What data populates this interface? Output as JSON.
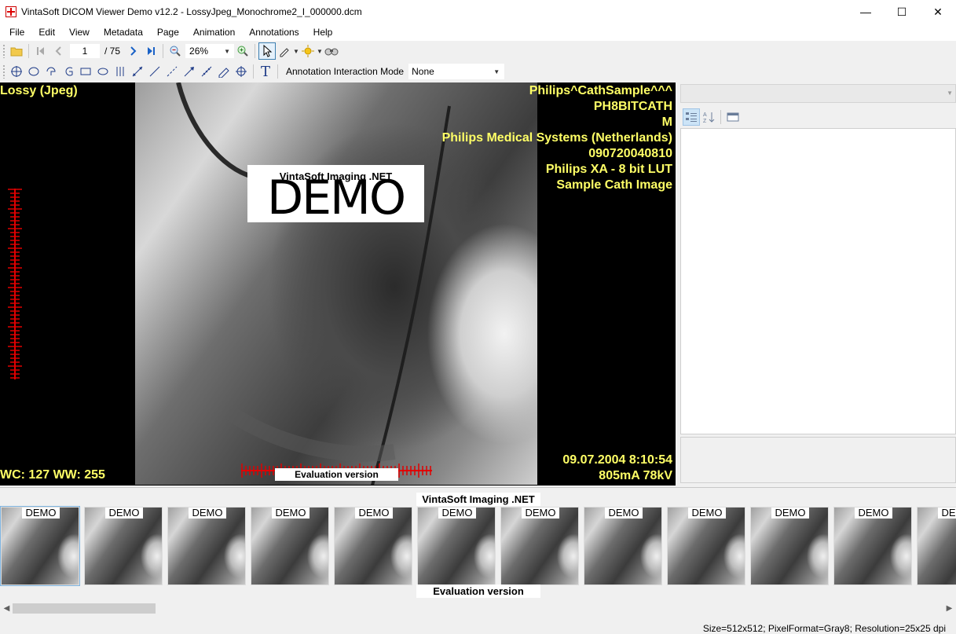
{
  "window": {
    "title": "VintaSoft DICOM Viewer Demo v12.2 - LossyJpeg_Monochrome2_I_000000.dcm",
    "minimize": "—",
    "maximize": "☐",
    "close": "✕"
  },
  "menu": [
    "File",
    "Edit",
    "View",
    "Metadata",
    "Page",
    "Animation",
    "Annotations",
    "Help"
  ],
  "toolbar": {
    "page_current": "1",
    "page_total": "/ 75",
    "zoom": "26%",
    "interaction_mode_label": "Annotation Interaction Mode",
    "interaction_mode_value": "None"
  },
  "viewer": {
    "top_left": "Lossy (Jpeg)",
    "top_right": [
      "Philips^CathSample^^^",
      "PH8BITCATH",
      "M",
      "Philips Medical Systems (Netherlands)",
      "090720040810",
      "Philips XA - 8 bit LUT",
      "Sample Cath Image"
    ],
    "bottom_left": "WC: 127 WW: 255",
    "bottom_right": [
      "09.07.2004 8:10:54",
      "805mA 78kV"
    ],
    "watermark_caption": "VintaSoft Imaging .NET",
    "watermark_big": "DEMO",
    "evaluation": "Evaluation version",
    "overlay_color": "#ffff66",
    "ruler_color": "#e00000"
  },
  "thumbnails": {
    "caption_top": "VintaSoft Imaging .NET",
    "caption_bottom": "Evaluation version",
    "labels": [
      "DEMO",
      "DEMO",
      "DEMO",
      "DEMO",
      "DEMO",
      "DEMO",
      "DEMO",
      "DEMO",
      "DEMO",
      "DEMO",
      "DEMO",
      "DEMO"
    ]
  },
  "status": {
    "text": "Size=512x512; PixelFormat=Gray8; Resolution=25x25 dpi"
  }
}
